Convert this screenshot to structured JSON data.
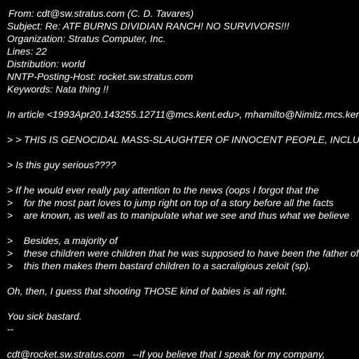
{
  "headers": {
    "from": "From: cdt@sw.stratus.com (C. D. Tavares)",
    "subject": "Subject: Re: ATF BURNS DIVIDIAN RANCH! NO SURVIVORS!!!",
    "organization": "Organization: Stratus Computer, Inc.",
    "lines": "Lines: 22",
    "distribution": "Distribution: world",
    "nntp_host": "NNTP-Posting-Host: rocket.sw.stratus.com",
    "keywords": "Keywords: Nata thing !!"
  },
  "body": {
    "attribution": "In article <1993Apr20.143255.12711@mcs.kent.edu>, mhamilto@Nimitz.mcs.kent.edu",
    "quote_1": "> > THIS IS GENOCIDAL MASS-SLAUGHTER OF INNOCENT PEOPLE, INCLUDING",
    "quote_2": "> Is this guy serious????",
    "quote_3a": "> If he would ever really pay attention to the news (oops I forgot that the",
    "quote_3b": ">    for the most part loves to jump right on top of a story before all the facts",
    "quote_3c": ">    are known, as well as to manipulate what we see and thus what we believe",
    "quote_4a": ">    Besides, a majority of",
    "quote_4b": ">    these children were children that he was supposed to have been the father of",
    "quote_4c": ">    this then makes them bastard children to a sacraligious zeloit (sp).",
    "reply_1": "Oh, then, I guess that shooting THOSE kind of babies is all right.",
    "reply_2": "You sick bastard.",
    "sig_sep": "--",
    "sig_line": "cdt@rocket.sw.stratus.com   --If you believe that I speak for my company,"
  }
}
